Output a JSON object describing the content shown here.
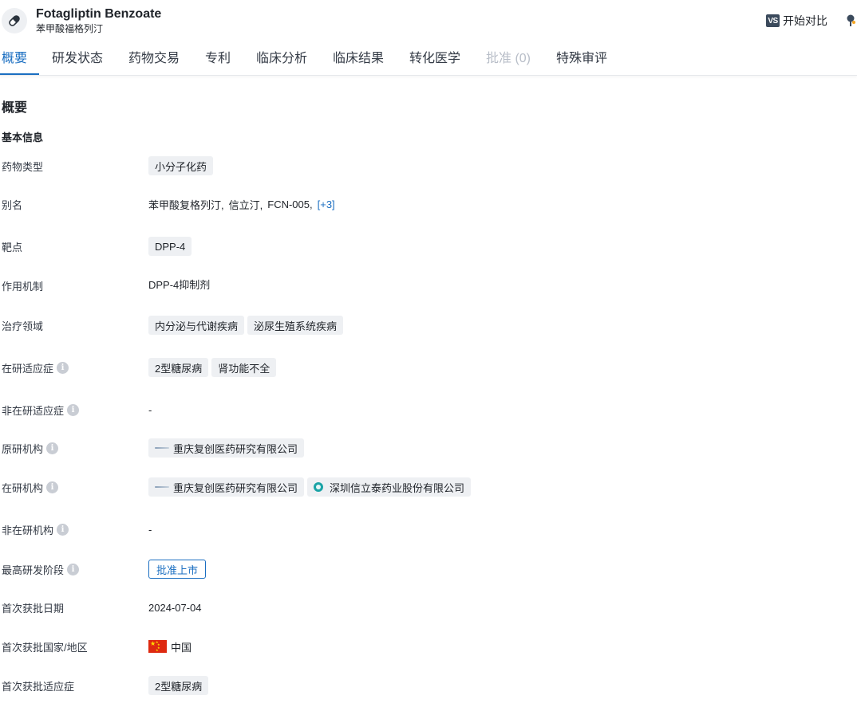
{
  "header": {
    "title": "Fotagliptin Benzoate",
    "subtitle": "苯甲酸福格列汀",
    "compare_badge": "VS",
    "compare_label": "开始对比"
  },
  "tabs": [
    {
      "label": "概要",
      "state": "active"
    },
    {
      "label": "研发状态",
      "state": "normal"
    },
    {
      "label": "药物交易",
      "state": "normal"
    },
    {
      "label": "专利",
      "state": "normal"
    },
    {
      "label": "临床分析",
      "state": "normal"
    },
    {
      "label": "临床结果",
      "state": "normal"
    },
    {
      "label": "转化医学",
      "state": "normal"
    },
    {
      "label": "批准 (0)",
      "state": "disabled"
    },
    {
      "label": "特殊审评",
      "state": "normal"
    }
  ],
  "overview": {
    "section_title": "概要",
    "subsection_title": "基本信息",
    "rows": {
      "drug_type": {
        "label": "药物类型",
        "tags": [
          "小分子化药"
        ]
      },
      "alias": {
        "label": "别名",
        "values": [
          "苯甲酸复格列汀,",
          "信立汀,",
          "FCN-005,"
        ],
        "more_link": "[+3]"
      },
      "target": {
        "label": "靶点",
        "tags": [
          "DPP-4"
        ]
      },
      "mechanism": {
        "label": "作用机制",
        "value": "DPP-4抑制剂"
      },
      "therapeutic_area": {
        "label": "治疗领域",
        "tags": [
          "内分泌与代谢疾病",
          "泌尿生殖系统疾病"
        ]
      },
      "active_indication": {
        "label": "在研适应症",
        "tags": [
          "2型糖尿病",
          "肾功能不全"
        ]
      },
      "inactive_indication": {
        "label": "非在研适应症",
        "value": "-"
      },
      "originator": {
        "label": "原研机构",
        "orgs": [
          "重庆复创医药研究有限公司"
        ]
      },
      "active_org": {
        "label": "在研机构",
        "orgs": [
          "重庆复创医药研究有限公司",
          "深圳信立泰药业股份有限公司"
        ]
      },
      "inactive_org": {
        "label": "非在研机构",
        "value": "-"
      },
      "highest_phase": {
        "label": "最高研发阶段",
        "tag": "批准上市"
      },
      "first_approval_date": {
        "label": "首次获批日期",
        "value": "2024-07-04"
      },
      "first_approval_country": {
        "label": "首次获批国家/地区",
        "value": "中国"
      },
      "first_approval_indication": {
        "label": "首次获批适应症",
        "tags": [
          "2型糖尿病"
        ]
      }
    }
  },
  "colors": {
    "accent": "#1a6ec1",
    "tag_bg": "#eef0f3",
    "disabled": "#b8bec8"
  },
  "icons": {
    "avatar": "pill-icon",
    "info": "info-icon",
    "extra": "pin-icon",
    "flag": "china-flag-icon"
  }
}
